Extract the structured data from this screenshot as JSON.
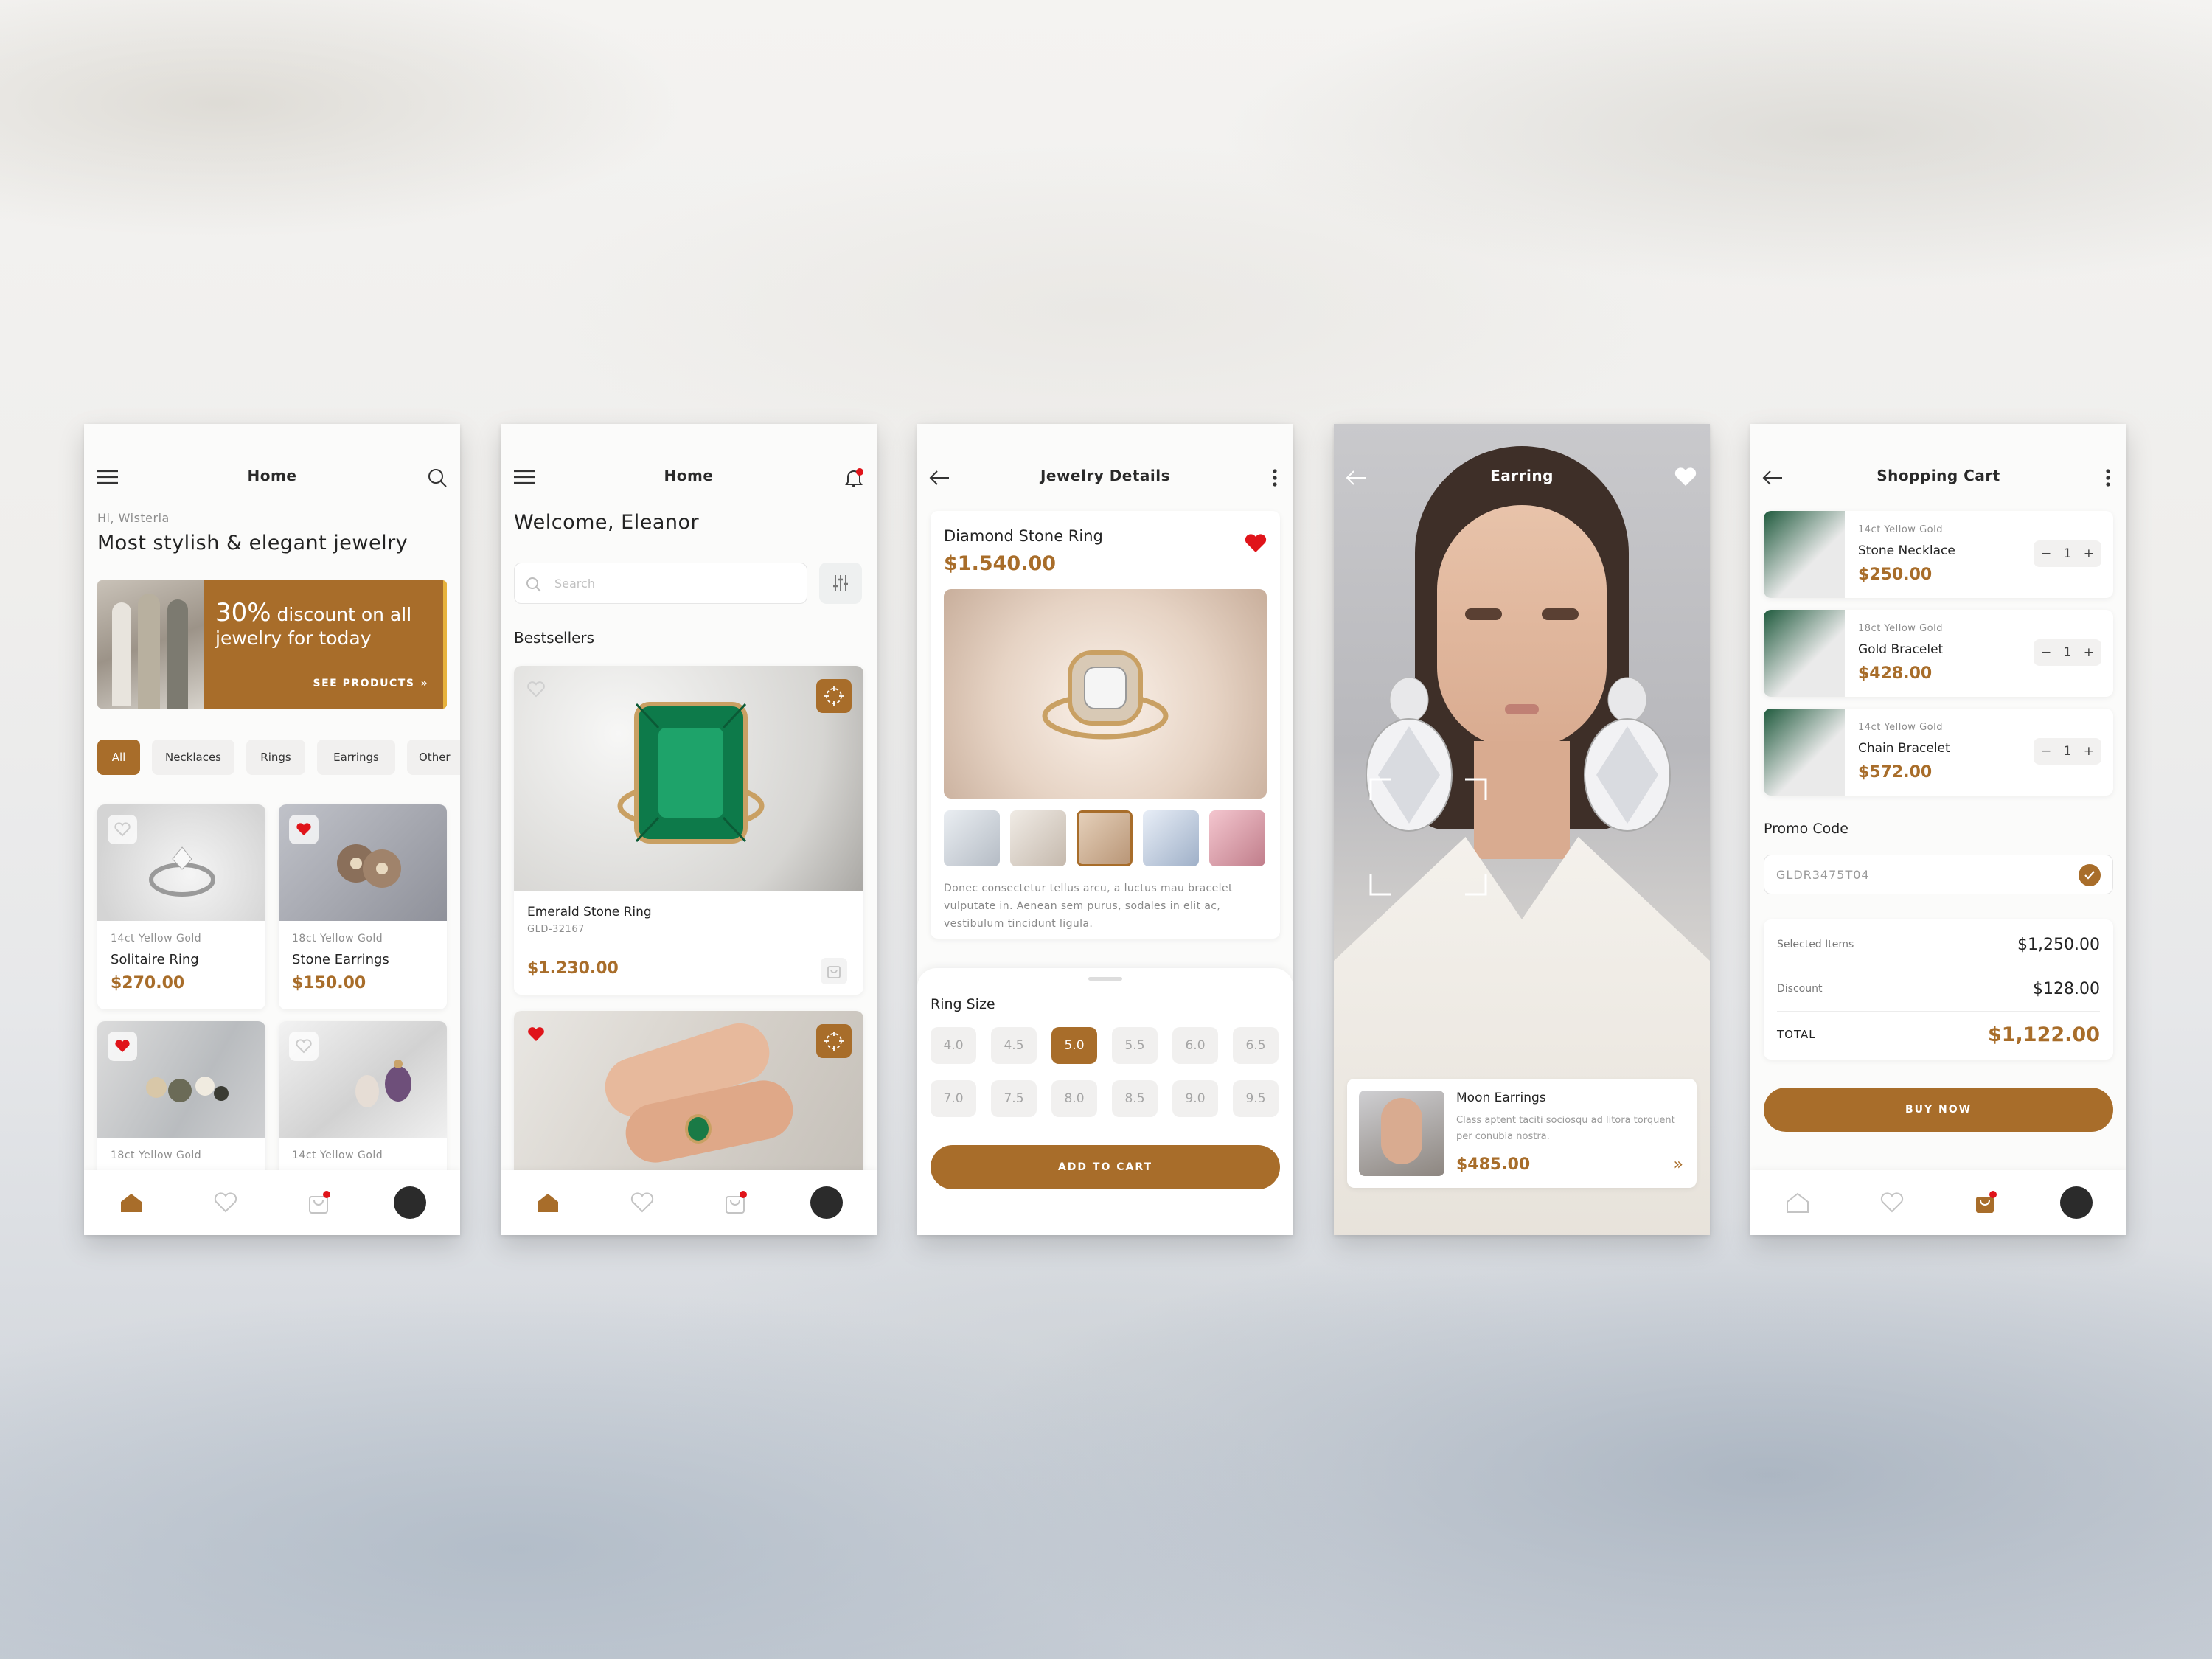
{
  "colors": {
    "accent": "#a86d2a",
    "favorite": "#e0141a",
    "background": "#f2f1ef"
  },
  "s1": {
    "title": "Home",
    "greeting": "Hi, Wisteria",
    "headline": "Most stylish & elegant jewelry",
    "banner": {
      "discount": "30%",
      "text1": "discount on all",
      "text2": "jewelry for today",
      "cta": "SEE PRODUCTS"
    },
    "categories": [
      "All",
      "Necklaces",
      "Rings",
      "Earrings",
      "Other"
    ],
    "products": [
      {
        "meta": "14ct Yellow Gold",
        "name": "Solitaire Ring",
        "price": "$270.00",
        "favorite": false
      },
      {
        "meta": "18ct Yellow Gold",
        "name": "Stone Earrings",
        "price": "$150.00",
        "favorite": true
      },
      {
        "meta": "18ct Yellow Gold",
        "favorite": true
      },
      {
        "meta": "14ct Yellow Gold",
        "favorite": false
      }
    ]
  },
  "s2": {
    "title": "Home",
    "welcome": "Welcome, Eleanor",
    "search_placeholder": "Search",
    "section": "Bestsellers",
    "product": {
      "name": "Emerald Stone Ring",
      "code": "GLD-32167",
      "price": "$1.230.00"
    }
  },
  "s3": {
    "title": "Jewelry Details",
    "name": "Diamond Stone Ring",
    "price": "$1.540.00",
    "description": "Donec consectetur tellus arcu, a luctus mau bracelet vulputate in. Aenean sem purus, sodales in elit ac, vestibulum tincidunt ligula.",
    "size_label": "Ring Size",
    "sizes": [
      "4.0",
      "4.5",
      "5.0",
      "5.5",
      "6.0",
      "6.5",
      "7.0",
      "7.5",
      "8.0",
      "8.5",
      "9.0",
      "9.5"
    ],
    "selected_size": "5.0",
    "cta": "ADD TO CART"
  },
  "s4": {
    "title": "Earring",
    "name": "Moon Earrings",
    "desc": "Class aptent taciti sociosqu ad litora torquent per conubia nostra.",
    "price": "$485.00"
  },
  "s5": {
    "title": "Shopping Cart",
    "items": [
      {
        "meta": "14ct Yellow Gold",
        "name": "Stone Necklace",
        "price": "$250.00",
        "qty": "1"
      },
      {
        "meta": "18ct Yellow Gold",
        "name": "Gold Bracelet",
        "price": "$428.00",
        "qty": "1"
      },
      {
        "meta": "14ct Yellow Gold",
        "name": "Chain Bracelet",
        "price": "$572.00",
        "qty": "1"
      }
    ],
    "promo_label": "Promo Code",
    "promo_value": "GLDR3475T04",
    "summary": {
      "selected_label": "Selected Items",
      "selected": "$1,250.00",
      "discount_label": "Discount",
      "discount": "$128.00",
      "total_label": "TOTAL",
      "total": "$1,122.00"
    },
    "cta": "BUY NOW"
  }
}
